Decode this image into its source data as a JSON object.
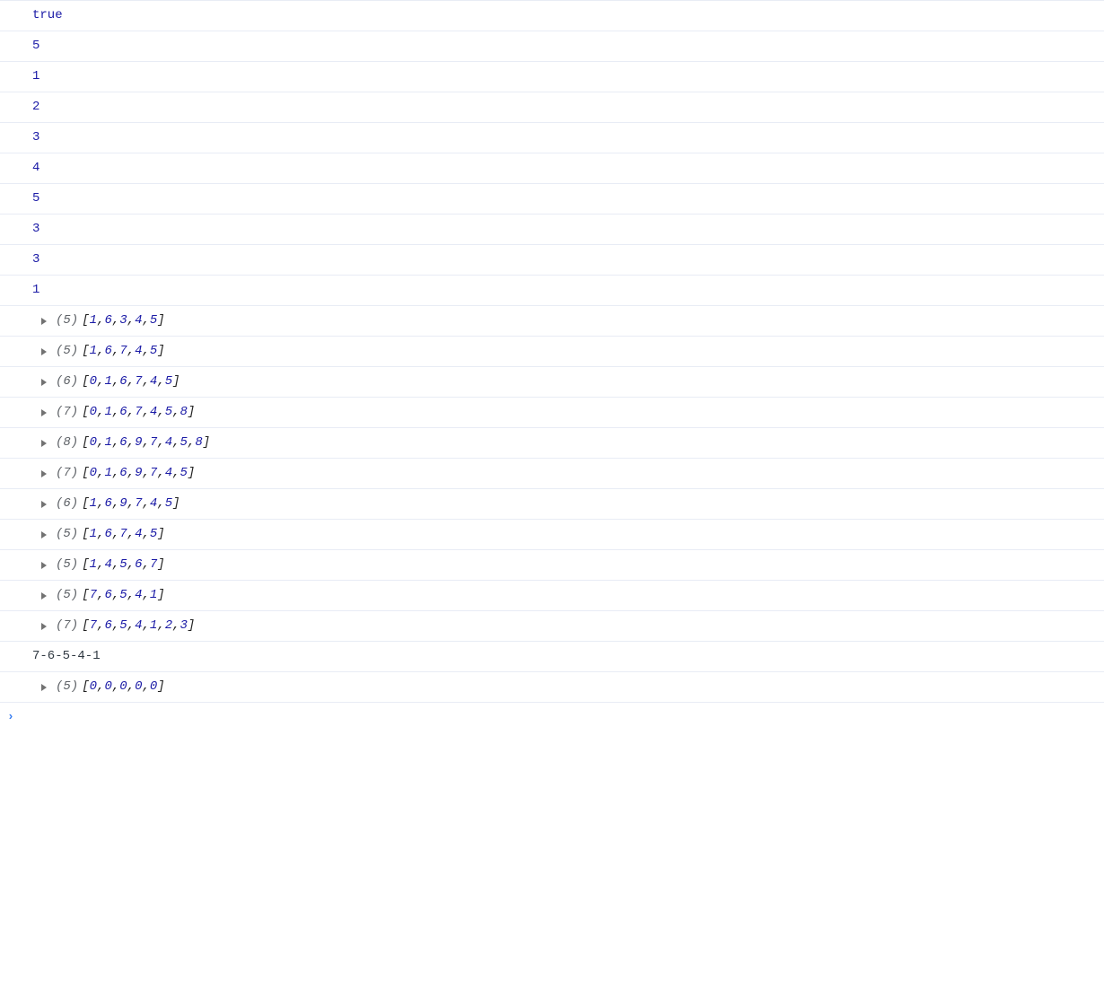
{
  "rows": [
    {
      "type": "bool",
      "value": "true"
    },
    {
      "type": "num",
      "value": "5"
    },
    {
      "type": "num",
      "value": "1"
    },
    {
      "type": "num",
      "value": "2"
    },
    {
      "type": "num",
      "value": "3"
    },
    {
      "type": "num",
      "value": "4"
    },
    {
      "type": "num",
      "value": "5"
    },
    {
      "type": "num",
      "value": "3"
    },
    {
      "type": "num",
      "value": "3"
    },
    {
      "type": "num",
      "value": "1"
    },
    {
      "type": "array",
      "length": "(5)",
      "items": [
        "1",
        "6",
        "3",
        "4",
        "5"
      ]
    },
    {
      "type": "array",
      "length": "(5)",
      "items": [
        "1",
        "6",
        "7",
        "4",
        "5"
      ]
    },
    {
      "type": "array",
      "length": "(6)",
      "items": [
        "0",
        "1",
        "6",
        "7",
        "4",
        "5"
      ]
    },
    {
      "type": "array",
      "length": "(7)",
      "items": [
        "0",
        "1",
        "6",
        "7",
        "4",
        "5",
        "8"
      ]
    },
    {
      "type": "array",
      "length": "(8)",
      "items": [
        "0",
        "1",
        "6",
        "9",
        "7",
        "4",
        "5",
        "8"
      ]
    },
    {
      "type": "array",
      "length": "(7)",
      "items": [
        "0",
        "1",
        "6",
        "9",
        "7",
        "4",
        "5"
      ]
    },
    {
      "type": "array",
      "length": "(6)",
      "items": [
        "1",
        "6",
        "9",
        "7",
        "4",
        "5"
      ]
    },
    {
      "type": "array",
      "length": "(5)",
      "items": [
        "1",
        "6",
        "7",
        "4",
        "5"
      ]
    },
    {
      "type": "array",
      "length": "(5)",
      "items": [
        "1",
        "4",
        "5",
        "6",
        "7"
      ]
    },
    {
      "type": "array",
      "length": "(5)",
      "items": [
        "7",
        "6",
        "5",
        "4",
        "1"
      ]
    },
    {
      "type": "array",
      "length": "(7)",
      "items": [
        "7",
        "6",
        "5",
        "4",
        "1",
        "2",
        "3"
      ]
    },
    {
      "type": "string",
      "value": "7-6-5-4-1"
    },
    {
      "type": "array",
      "length": "(5)",
      "items": [
        "0",
        "0",
        "0",
        "0",
        "0"
      ]
    }
  ],
  "prompt": "›"
}
